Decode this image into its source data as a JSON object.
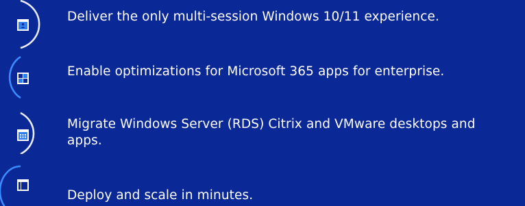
{
  "theme": {
    "background": "#0a2896",
    "arc_white": "#e6ebf5",
    "arc_blue": "#3c8cff",
    "icon_blue": "#2f7ff0"
  },
  "features": [
    {
      "icon": "desktop-user-icon",
      "text": "Deliver the only multi-session Windows 10/11 experience."
    },
    {
      "icon": "app-tiles-icon",
      "text": "Enable optimizations for Microsoft 365 apps for enterprise."
    },
    {
      "icon": "app-grid-window-icon",
      "text": "Migrate Windows Server (RDS) Citrix and VMware desktops and apps."
    },
    {
      "icon": "scale-window-icon",
      "text": "Deploy and scale in minutes."
    }
  ]
}
